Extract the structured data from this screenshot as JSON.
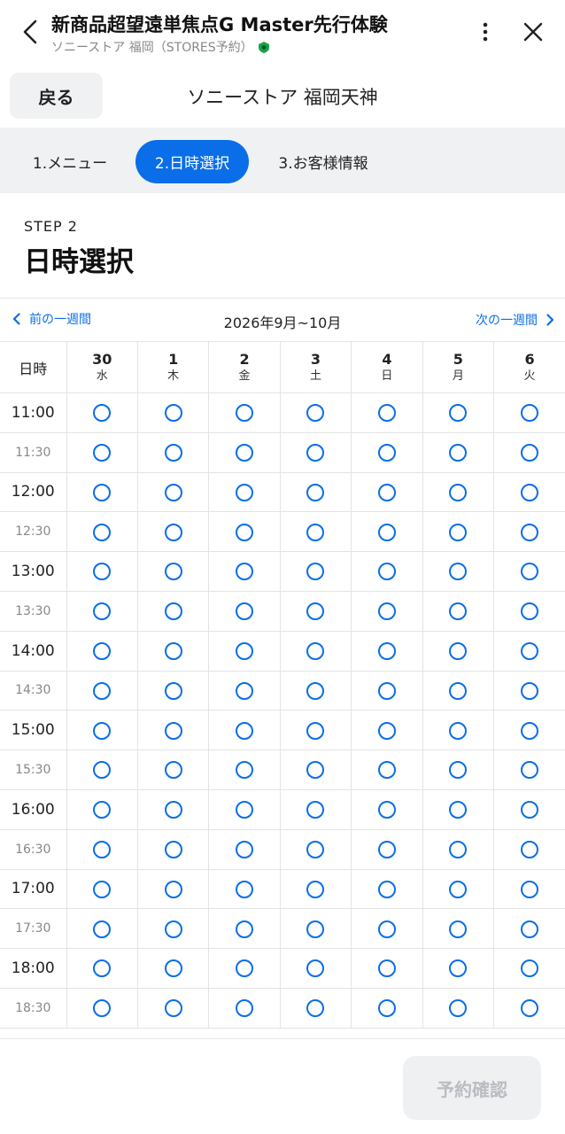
{
  "appbar": {
    "title": "新商品超望遠単焦点G Master先行体験",
    "subtitle": "ソニーストア 福岡（STORES予約）"
  },
  "header": {
    "back_label": "戻る",
    "store_name": "ソニーストア 福岡天神"
  },
  "steps": [
    {
      "label": "1.メニュー",
      "active": false
    },
    {
      "label": "2.日時選択",
      "active": true
    },
    {
      "label": "3.お客様情報",
      "active": false
    }
  ],
  "step_heading": {
    "label": "STEP 2",
    "title": "日時選択"
  },
  "week_nav": {
    "prev_label": "前の一週間",
    "period": "2026年9月~10月",
    "next_label": "次の一週間"
  },
  "calendar": {
    "corner_label": "日時",
    "days": [
      {
        "num": "30",
        "weekday": "水"
      },
      {
        "num": "1",
        "weekday": "木"
      },
      {
        "num": "2",
        "weekday": "金"
      },
      {
        "num": "3",
        "weekday": "土"
      },
      {
        "num": "4",
        "weekday": "日"
      },
      {
        "num": "5",
        "weekday": "月"
      },
      {
        "num": "6",
        "weekday": "火"
      }
    ],
    "times": [
      "11:00",
      "11:30",
      "12:00",
      "12:30",
      "13:00",
      "13:30",
      "14:00",
      "14:30",
      "15:00",
      "15:30",
      "16:00",
      "16:30",
      "17:00",
      "17:30",
      "18:00",
      "18:30"
    ],
    "slot_symbol": "available-circle"
  },
  "footer": {
    "confirm_label": "予約確認"
  },
  "colors": {
    "accent": "#0a6ee8",
    "step_bar_bg": "#f0f1f2",
    "disabled_text": "#b9bdc1"
  }
}
